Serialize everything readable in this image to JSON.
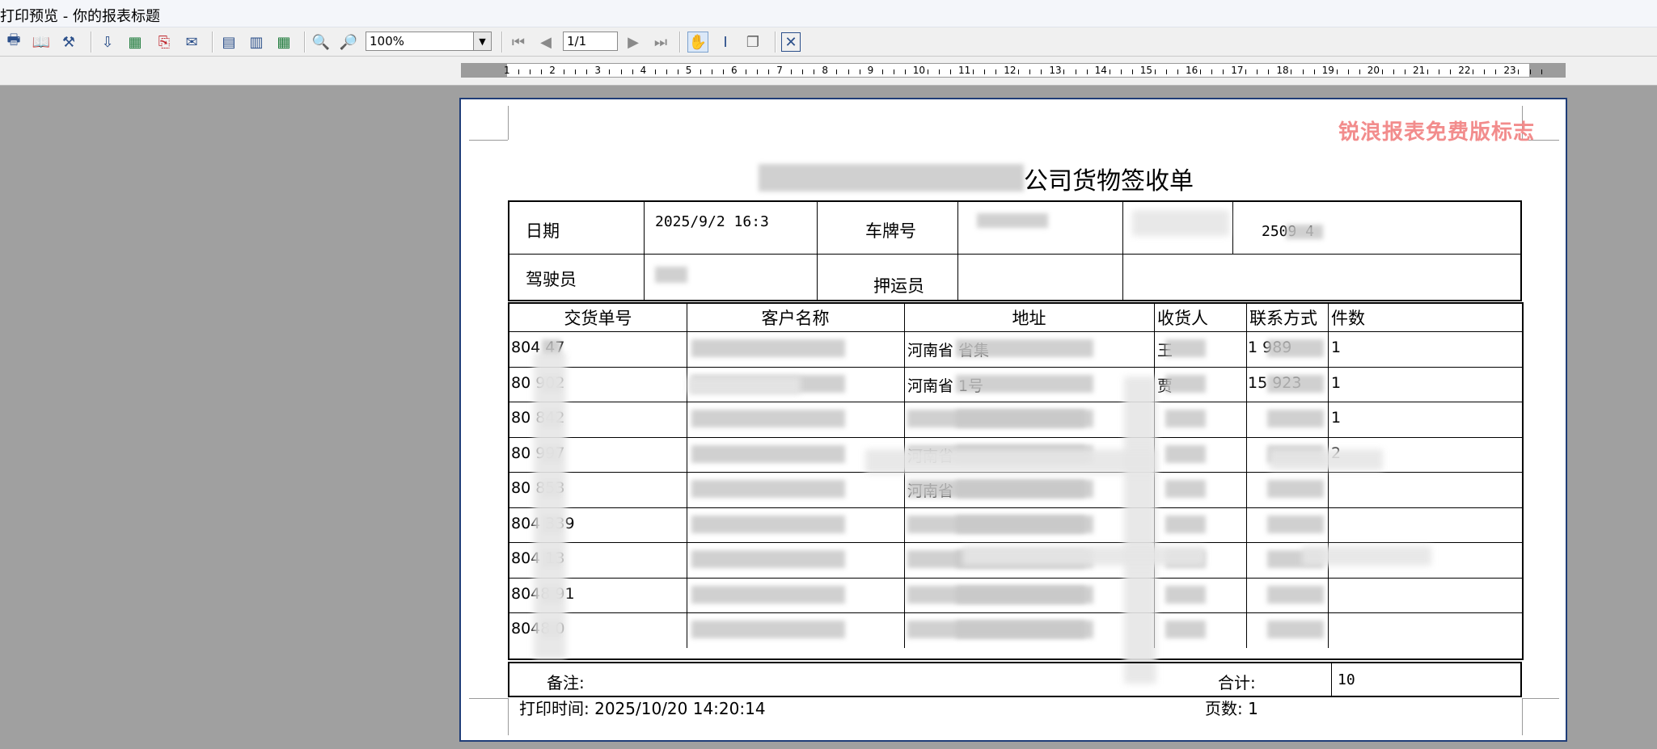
{
  "window": {
    "title": "打印预览 - 你的报表标题"
  },
  "toolbar": {
    "zoom_value": "100%",
    "page_value": "1/1",
    "buttons": [
      "print-icon",
      "book-icon",
      "tools-icon",
      "export-icon",
      "excel-icon",
      "pdf-icon",
      "mail-icon",
      "single-page-icon",
      "two-page-icon",
      "multi-page-icon",
      "zoom-in-icon",
      "zoom-out-icon",
      "first-page-icon",
      "prev-page-icon",
      "next-page-icon",
      "last-page-icon",
      "hand-tool-icon",
      "text-select-icon",
      "copy-icon",
      "close-icon"
    ]
  },
  "ruler": {
    "labels": [
      "1",
      "2",
      "3",
      "4",
      "5",
      "6",
      "7",
      "8",
      "9",
      "10",
      "11",
      "12",
      "13",
      "14",
      "15",
      "16",
      "17",
      "18",
      "19",
      "20",
      "21",
      "22",
      "23"
    ]
  },
  "report": {
    "watermark": "锐浪报表免费版标志",
    "title_visible": "公司货物签收单",
    "header": {
      "date_label": "日期",
      "date_value": "2025/9/2 16:3",
      "plate_label": "车牌号",
      "waybill_value": "2509 4",
      "driver_label": "驾驶员",
      "escort_label": "押运员"
    },
    "columns": [
      "交货单号",
      "客户名称",
      "地址",
      "收货人",
      "联系方式",
      "件数"
    ],
    "rows": [
      {
        "no": "804  47",
        "addr": "河南省          省集",
        "rcv": "王",
        "phone": "1    989",
        "qty": "1"
      },
      {
        "no": "80   902",
        "addr": "河南省          1号",
        "rcv": "贾",
        "phone": "15    923",
        "qty": "1"
      },
      {
        "no": "80   842",
        "addr": "",
        "rcv": "",
        "phone": "",
        "qty": "1"
      },
      {
        "no": "80   997",
        "addr": "河南省",
        "rcv": "",
        "phone": "",
        "qty": "2"
      },
      {
        "no": "80   853",
        "addr": "河南省",
        "rcv": "",
        "phone": "",
        "qty": ""
      },
      {
        "no": "804  339",
        "addr": "",
        "rcv": "",
        "phone": "",
        "qty": ""
      },
      {
        "no": "804  13",
        "addr": "",
        "rcv": "",
        "phone": "",
        "qty": ""
      },
      {
        "no": "8048  91",
        "addr": "",
        "rcv": "",
        "phone": "",
        "qty": ""
      },
      {
        "no": "8048  0",
        "addr": "",
        "rcv": "",
        "phone": "",
        "qty": ""
      }
    ],
    "footer": {
      "remark_label": "备注:",
      "total_label": "合计:",
      "total_value": "10"
    },
    "print_time": "打印时间: 2025/10/20 14:20:14",
    "page_count": "页数: 1"
  }
}
